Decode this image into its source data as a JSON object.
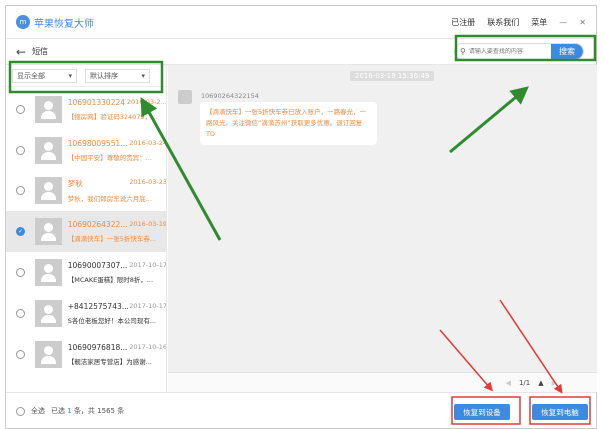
{
  "app": {
    "title": "苹果恢复大师",
    "logo_text": "m"
  },
  "titlebar": {
    "menu": [
      "已注册",
      "联系我们",
      "菜单"
    ],
    "minimize": "—",
    "close": "✕"
  },
  "subheader": {
    "back": "←",
    "title": "短信",
    "search_placeholder": "请输入要查找的内容",
    "search_button": "搜索"
  },
  "filters": {
    "show": "显示全部",
    "sort": "默认排序"
  },
  "list": [
    {
      "sender": "106901330224",
      "date": "2016-03-2…",
      "preview": "【搜房网】验证码324079，...",
      "unread": true,
      "selected": false
    },
    {
      "sender": "10698009551...",
      "date": "2016-03-24",
      "preview": "【中国平安】尊敬的贵宾：...",
      "unread": true,
      "selected": false
    },
    {
      "sender": "梦秋",
      "date": "2016-03-23",
      "preview": "梦秋，我们郎房东说六月底...",
      "unread": true,
      "selected": false
    },
    {
      "sender": "10690264322...",
      "date": "2016-03-19",
      "preview": "【滴滴快车】一张5折快车券...",
      "unread": true,
      "selected": true
    },
    {
      "sender": "10690007307...",
      "date": "2017-10-17",
      "preview": "【MCAKE蛋糕】限时8折，...",
      "unread": false,
      "selected": false
    },
    {
      "sender": "+8412575743...",
      "date": "2017-10-17",
      "preview": "S各位老板您好！本公司现有...",
      "unread": false,
      "selected": false
    },
    {
      "sender": "10690976818...",
      "date": "2017-10-16",
      "preview": "【靓洁家居专营店】为感谢...",
      "unread": false,
      "selected": false
    }
  ],
  "conversation": {
    "timestamp": "2016-03-19 15:36:49",
    "sender": "10690264322154",
    "message": "【滴滴快车】一张5折快车券已放入账户，一路春光，一路风光。关注微信“滴滴苏州”获取更多优惠。退订回复TD"
  },
  "pager": {
    "prev": "◀",
    "page": "1/1",
    "up": "▲",
    "next": "▶"
  },
  "footer": {
    "select_all": "全选",
    "selected_prefix": "已选",
    "selected_count": "1",
    "selected_mid": "条，共",
    "total": "1565",
    "unit": "条",
    "restore_device": "恢复到设备",
    "restore_pc": "恢复到电脑"
  },
  "colors": {
    "accent": "#3d8be0",
    "unread": "#f08a3c",
    "annotation_green": "#2e8b2e",
    "annotation_red": "#e53935"
  }
}
